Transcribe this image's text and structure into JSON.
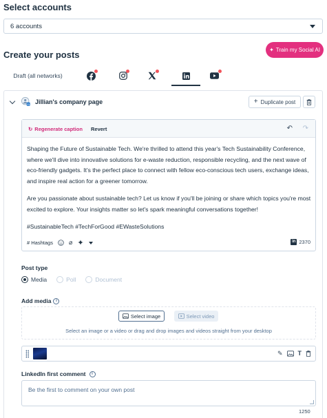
{
  "select_accounts": {
    "title": "Select accounts",
    "value": "6 accounts",
    "icon": "caret-down-icon"
  },
  "create": {
    "title": "Create your posts",
    "train_button": "Train my Social AI",
    "train_icon": "sparkle-icon"
  },
  "tabs": [
    {
      "label": "Draft (all networks)",
      "icon": ""
    },
    {
      "label": "",
      "icon": "facebook-icon",
      "has_alert": true
    },
    {
      "label": "",
      "icon": "instagram-icon",
      "has_alert": true
    },
    {
      "label": "",
      "icon": "x-icon",
      "has_alert": true
    },
    {
      "label": "",
      "icon": "linkedin-icon",
      "has_alert": false,
      "active": true
    },
    {
      "label": "",
      "icon": "youtube-icon",
      "has_alert": true
    }
  ],
  "page": {
    "name": "Jillian's company page",
    "duplicate_label": "Duplicate post"
  },
  "editor": {
    "regenerate_label": "Regenerate caption",
    "revert_label": "Revert",
    "paragraphs": [
      "Shaping the Future of Sustainable Tech. We're thrilled to attend this year's Tech Sustainability Conference, where we'll dive into innovative solutions for e-waste reduction, responsible recycling, and the next wave of eco-friendly gadgets. It's the perfect place to connect with fellow eco-conscious tech users, exchange ideas, and inspire real action for a greener tomorrow.",
      "Are you passionate about sustainable tech? Let us know if you'll be joining or share which topics you're most excited to explore. Your insights matter so let's spark meaningful conversations together!",
      "#SustainableTech #TechForGood #EWasteSolutions"
    ],
    "hashtags_label": "# Hashtags",
    "char_count": "2370"
  },
  "post_type": {
    "label": "Post type",
    "options": [
      "Media",
      "Poll",
      "Document"
    ],
    "selected": "Media"
  },
  "media": {
    "label": "Add media",
    "select_image": "Select image",
    "select_video": "Select video",
    "hint": "Select an image or a video or drag and drop images and videos straight from your desktop"
  },
  "comment": {
    "label": "LinkedIn first comment",
    "placeholder": "Be the first to comment on your own post",
    "count": "1250"
  },
  "colors": {
    "accent": "#e3307f",
    "alert_dot": "#f2545b",
    "text_dark": "#213343"
  }
}
